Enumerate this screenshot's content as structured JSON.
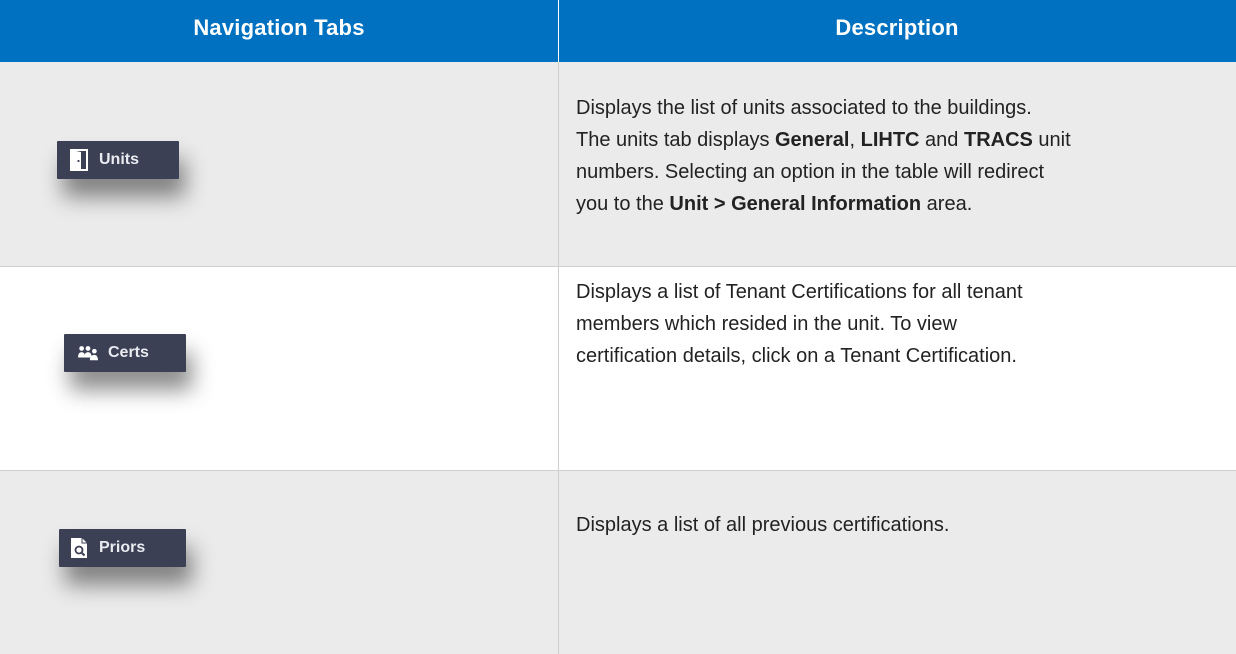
{
  "header": {
    "col1": "Navigation Tabs",
    "col2": "Description"
  },
  "rows": [
    {
      "tab": {
        "label": "Units",
        "icon": "door-icon"
      },
      "description": {
        "line1": "Displays the list of units associated to the buildings.",
        "line2_pre": "The units tab displays ",
        "general": "General",
        "comma": ", ",
        "lihtc": "LIHTC",
        "and": " and ",
        "tracs": "TRACS",
        "line2_post": " unit",
        "line3": "numbers. Selecting an option in the table will redirect",
        "line4_pre": "you to the ",
        "unit_link": "Unit > General Information",
        "line4_post": " area."
      }
    },
    {
      "tab": {
        "label": "Certs",
        "icon": "users-icon"
      },
      "description": {
        "line1": "Displays a list of Tenant Certifications for all tenant",
        "line2": "members which resided in the unit. To view",
        "line3": "certification details, click on a Tenant Certification."
      }
    },
    {
      "tab": {
        "label": "Priors",
        "icon": "document-search-icon"
      },
      "description": {
        "line1": "Displays a list of all previous certifications."
      }
    }
  ],
  "colors": {
    "header_bg": "#0070c0",
    "row_alt_bg": "#ebebeb",
    "tab_bg": "#3b4054"
  }
}
